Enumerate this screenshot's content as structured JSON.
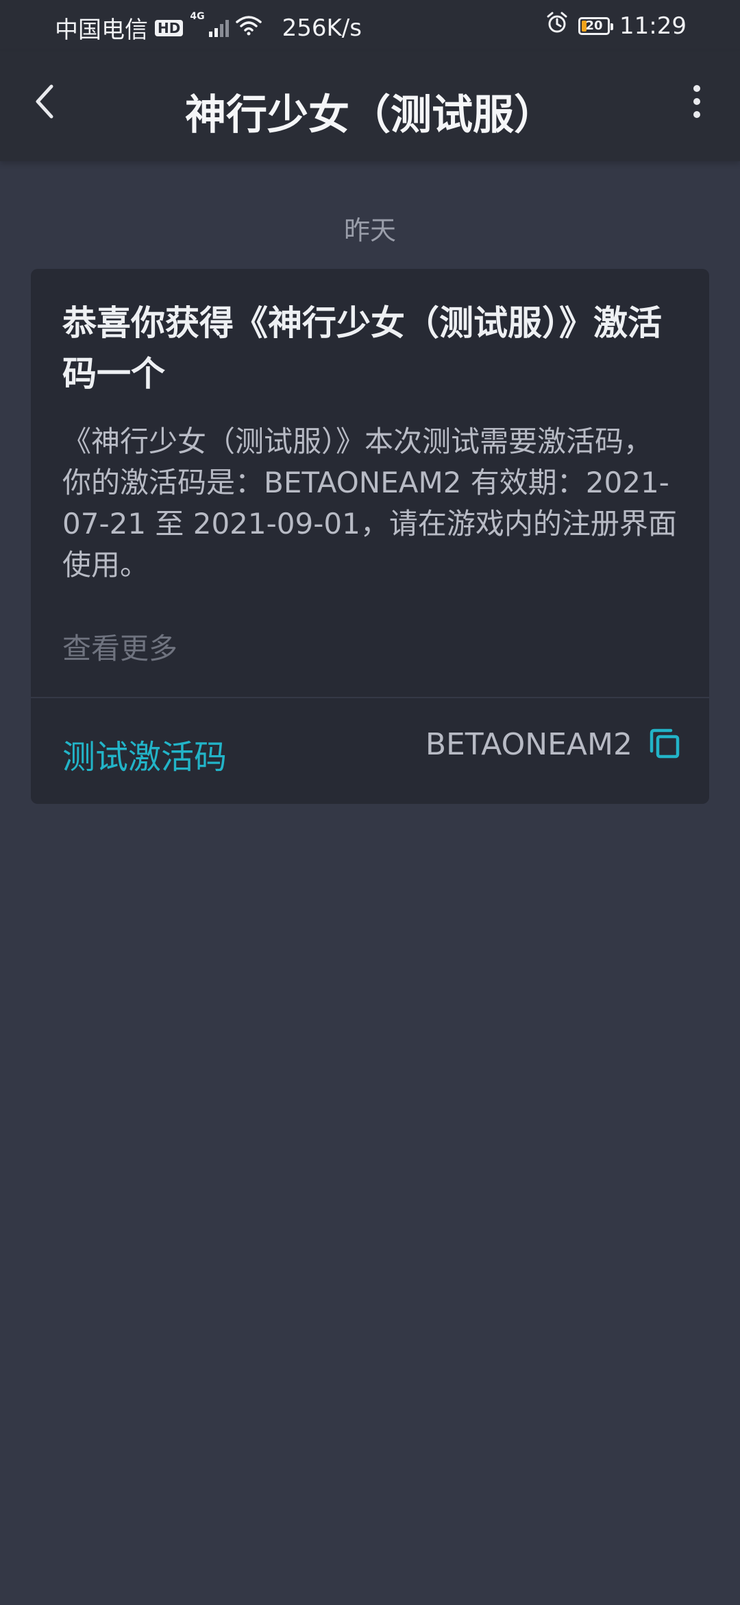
{
  "status_bar": {
    "carrier": "中国电信",
    "hd_badge": "HD",
    "network_type": "4G",
    "speed": "256K/s",
    "battery_level": "20",
    "battery_fraction": 0.2,
    "time": "11:29",
    "icons": [
      "signal-icon",
      "wifi-icon",
      "alarm-icon",
      "battery-icon"
    ]
  },
  "header": {
    "title": "神行少女（测试服）",
    "back_icon": "chevron-left-icon",
    "menu_icon": "more-vertical-icon"
  },
  "message": {
    "date": "昨天",
    "title": "恭喜你获得《神行少女（测试服）》激活码一个",
    "body": "《神行少女（测试服）》本次测试需要激活码，你的激活码是：BETAONEAM2 有效期：2021-07-21 至 2021-09-01，请在游戏内的注册界面使用。",
    "view_more": "查看更多",
    "code_label": "测试激活码",
    "code_value": "BETAONEAM2",
    "copy_icon": "copy-icon"
  },
  "colors": {
    "background": "#343846",
    "app_bar": "#2a2d36",
    "card": "#272a34",
    "accent": "#22b4c8",
    "battery_low": "#f2a31b"
  }
}
